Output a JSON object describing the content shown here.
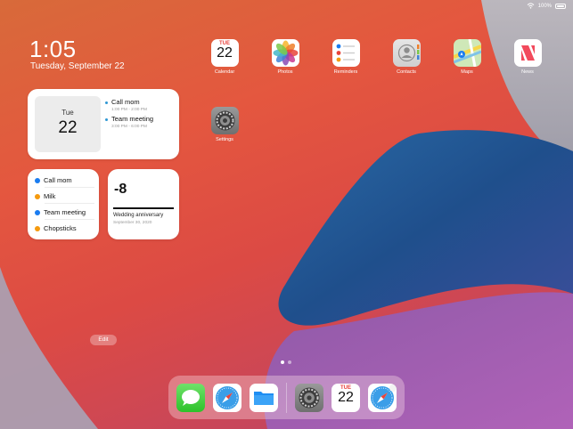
{
  "status": {
    "battery": "100%"
  },
  "lock": {
    "time": "1:05",
    "date": "Tuesday, September 22"
  },
  "calendar_widget": {
    "day_of_week": "Tue",
    "day": "22",
    "events": [
      {
        "title": "Call mom",
        "time": "1:00 PM - 2:00 PM"
      },
      {
        "title": "Team meeting",
        "time": "3:00 PM - 6:00 PM"
      }
    ]
  },
  "reminders_widget": {
    "items": [
      {
        "label": "Call mom",
        "color": "#1a7cf0"
      },
      {
        "label": "Milk",
        "color": "#f59a0e"
      },
      {
        "label": "Team meeting",
        "color": "#1a7cf0"
      },
      {
        "label": "Chopsticks",
        "color": "#f59a0e"
      }
    ]
  },
  "countdown_widget": {
    "value": "-8",
    "title": "Wedding anniversary",
    "date": "September 30, 2020"
  },
  "apps": {
    "calendar": {
      "label": "Calendar",
      "month": "TUE",
      "day": "22"
    },
    "photos": {
      "label": "Photos"
    },
    "reminders": {
      "label": "Reminders"
    },
    "contacts": {
      "label": "Contacts"
    },
    "maps": {
      "label": "Maps"
    },
    "news": {
      "label": "News"
    },
    "settings": {
      "label": "Settings"
    }
  },
  "edit_label": "Edit",
  "dock": {
    "calendar_month": "TUE",
    "calendar_day": "22"
  },
  "colors": {
    "reminder_blue": "#1a7cf0",
    "reminder_orange": "#f59a0e",
    "event_dot": "#2f97d4"
  }
}
